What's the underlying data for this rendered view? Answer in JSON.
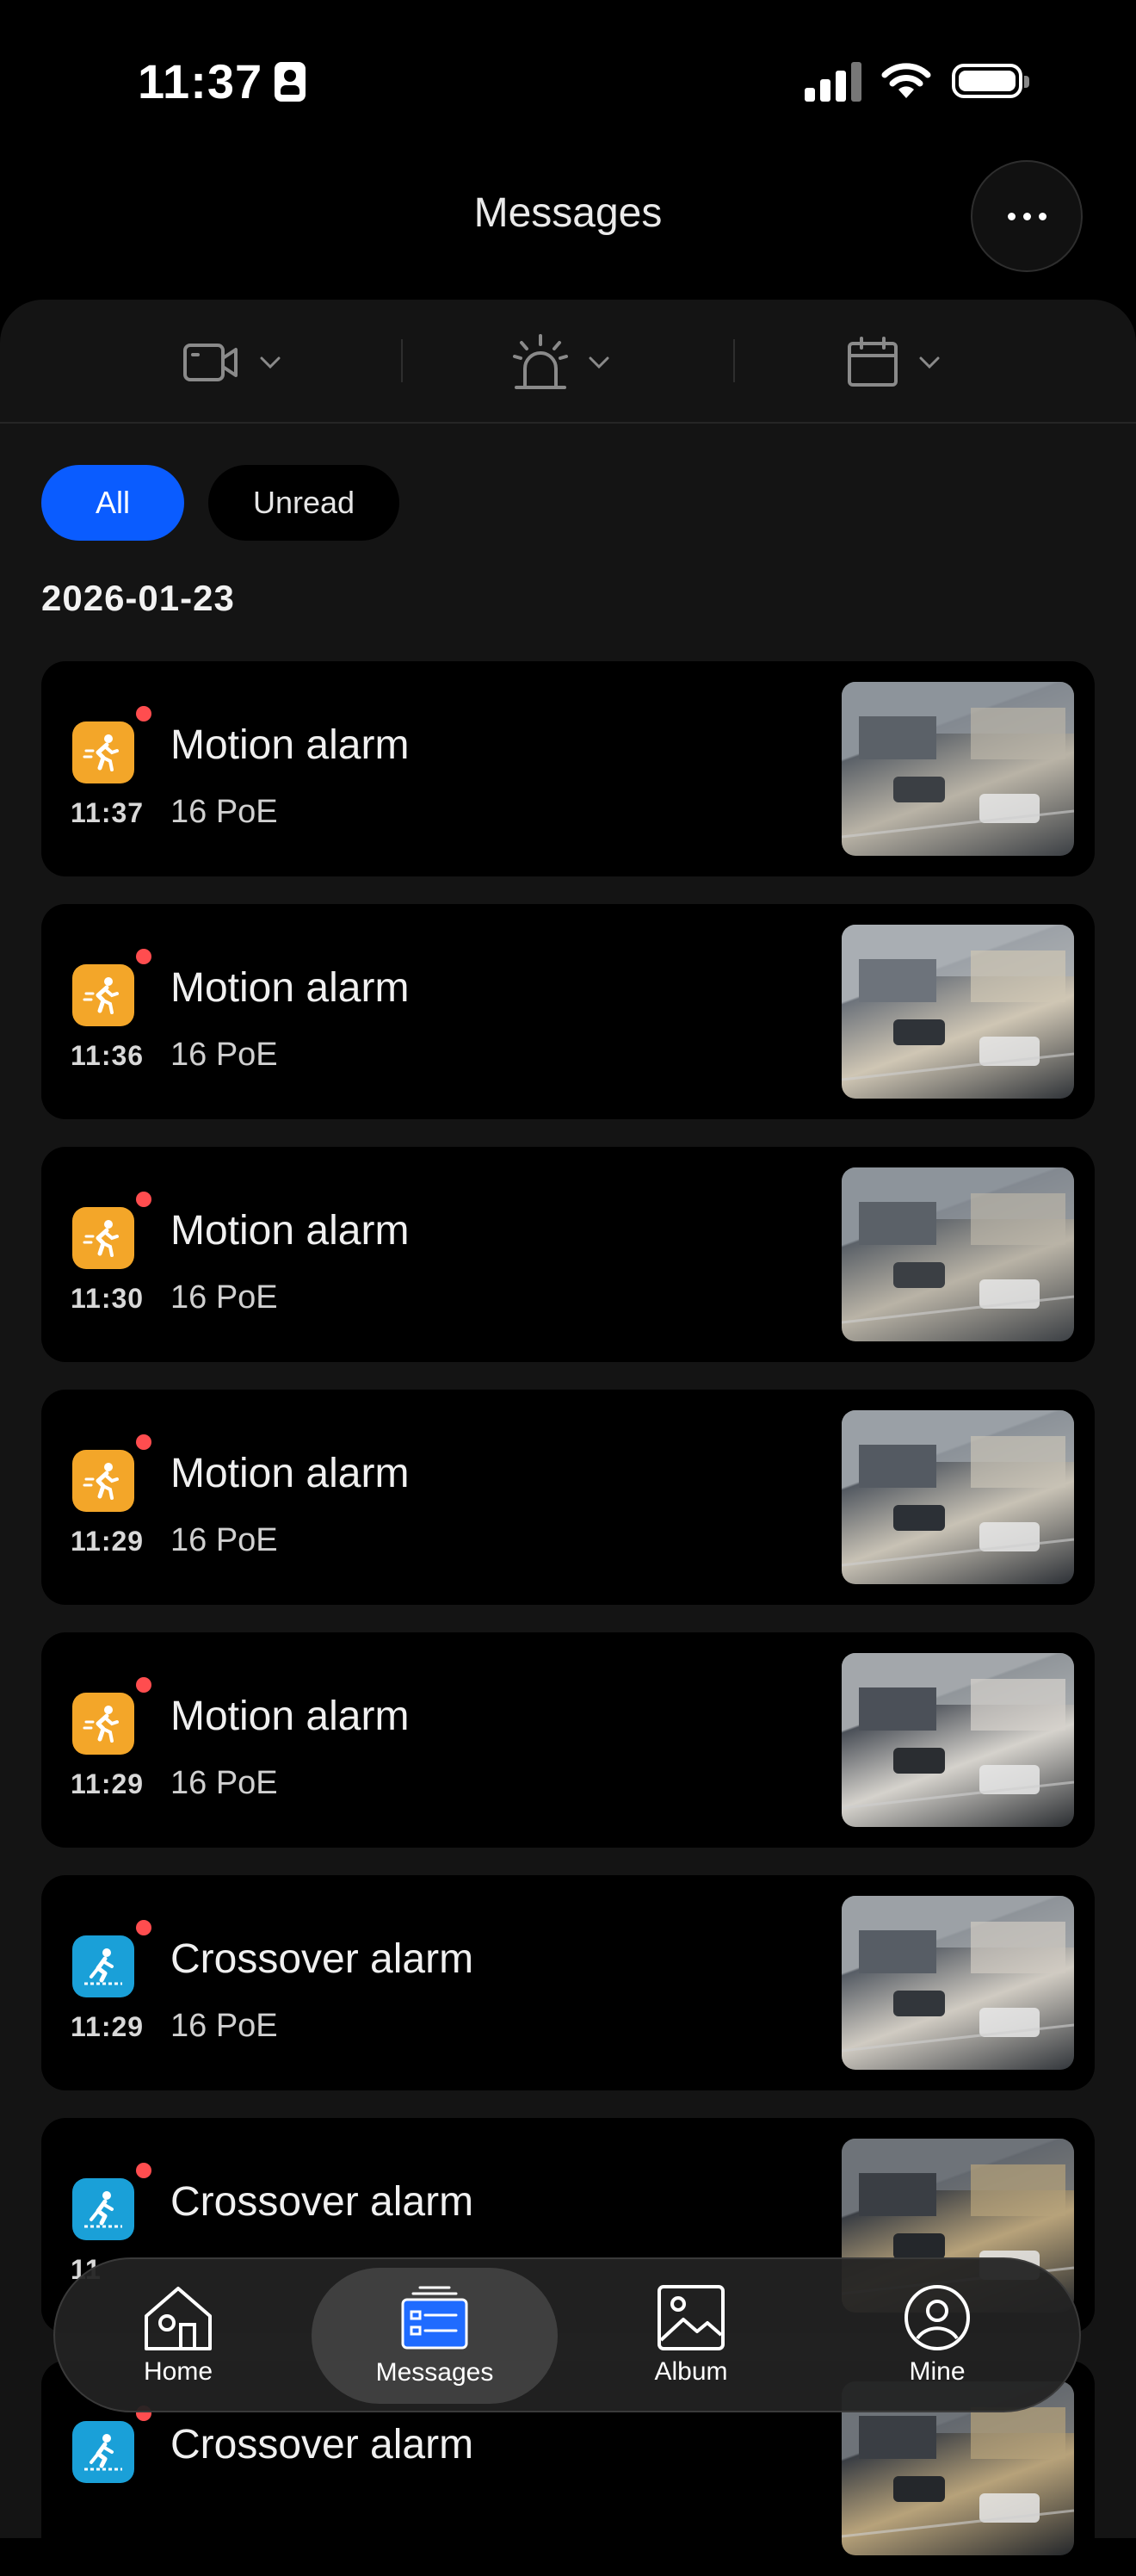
{
  "status": {
    "time": "11:37"
  },
  "header": {
    "title": "Messages",
    "more_icon": "more-dots-icon"
  },
  "filters": [
    {
      "icon": "camera-icon"
    },
    {
      "icon": "alarm-siren-icon"
    },
    {
      "icon": "calendar-icon"
    }
  ],
  "chips": {
    "all": "All",
    "unread": "Unread",
    "active_color": "#0a5cff"
  },
  "date": "2026-01-23",
  "messages": [
    {
      "type": "motion",
      "title": "Motion alarm",
      "time": "11:37",
      "device": "16 PoE",
      "unread": true
    },
    {
      "type": "motion",
      "title": "Motion alarm",
      "time": "11:36",
      "device": "16 PoE",
      "unread": true
    },
    {
      "type": "motion",
      "title": "Motion alarm",
      "time": "11:30",
      "device": "16 PoE",
      "unread": true
    },
    {
      "type": "motion",
      "title": "Motion alarm",
      "time": "11:29",
      "device": "16 PoE",
      "unread": true
    },
    {
      "type": "motion",
      "title": "Motion alarm",
      "time": "11:29",
      "device": "16 PoE",
      "unread": true
    },
    {
      "type": "crossover",
      "title": "Crossover alarm",
      "time": "11:29",
      "device": "16 PoE",
      "unread": true
    },
    {
      "type": "crossover",
      "title": "Crossover alarm",
      "time": "11",
      "device": "",
      "unread": true
    },
    {
      "type": "crossover",
      "title": "Crossover alarm",
      "time": "",
      "device": "",
      "unread": true
    }
  ],
  "colors": {
    "motion": "#f3a629",
    "crossover": "#1aa0d8",
    "unread_dot": "#ff4d4f"
  },
  "tabs": [
    {
      "label": "Home",
      "icon": "home-icon"
    },
    {
      "label": "Messages",
      "icon": "messages-icon",
      "active": true
    },
    {
      "label": "Album",
      "icon": "album-icon"
    },
    {
      "label": "Mine",
      "icon": "profile-icon"
    }
  ]
}
